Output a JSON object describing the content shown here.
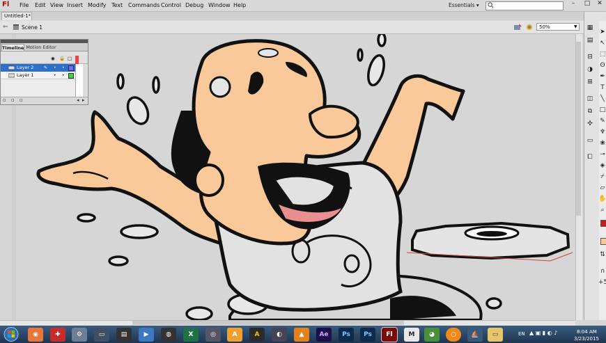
{
  "app": {
    "logo": "Fl"
  },
  "menu": [
    "File",
    "Edit",
    "View",
    "Insert",
    "Modify",
    "Text",
    "Commands",
    "Control",
    "Debug",
    "Window",
    "Help"
  ],
  "workspace": "Essentials",
  "document_tab": "Untitled-1*",
  "editbar": {
    "scene": "Scene 1",
    "zoom": "50%"
  },
  "timeline": {
    "tabs": [
      "Timeline",
      "Motion Editor"
    ],
    "layers": [
      {
        "name": "Layer 2",
        "selected": true,
        "color": "#6b6bff"
      },
      {
        "name": "Layer 1",
        "selected": false,
        "color": "#3fd43f"
      }
    ]
  },
  "taskbar": {
    "lang": "EN",
    "time": "8:04 AM",
    "date": "3/23/2015",
    "apps": [
      "firefox-icon",
      "red-app-icon",
      "settings-icon",
      "monitor-icon",
      "film-icon",
      "media-player-icon",
      "camera-icon",
      "excel-icon",
      "world-icon",
      "illustrator-a-icon",
      "a-icon",
      "media-icon",
      "after-effects-icon",
      "photoshop-icon",
      "photoshop-icon-2",
      "flash-icon",
      "m-icon",
      "chrome-icon",
      "orange-icon",
      "sail-icon",
      "folder-icon"
    ],
    "app_labels": {
      "ae": "Ae",
      "ps": "Ps",
      "ps2": "Ps",
      "fl": "Fl",
      "m": "M"
    }
  },
  "colors": {
    "skin": "#f9c99a",
    "outline": "#111111",
    "accent_selected": "#2e6fc9",
    "taskbar": "#26405c"
  }
}
